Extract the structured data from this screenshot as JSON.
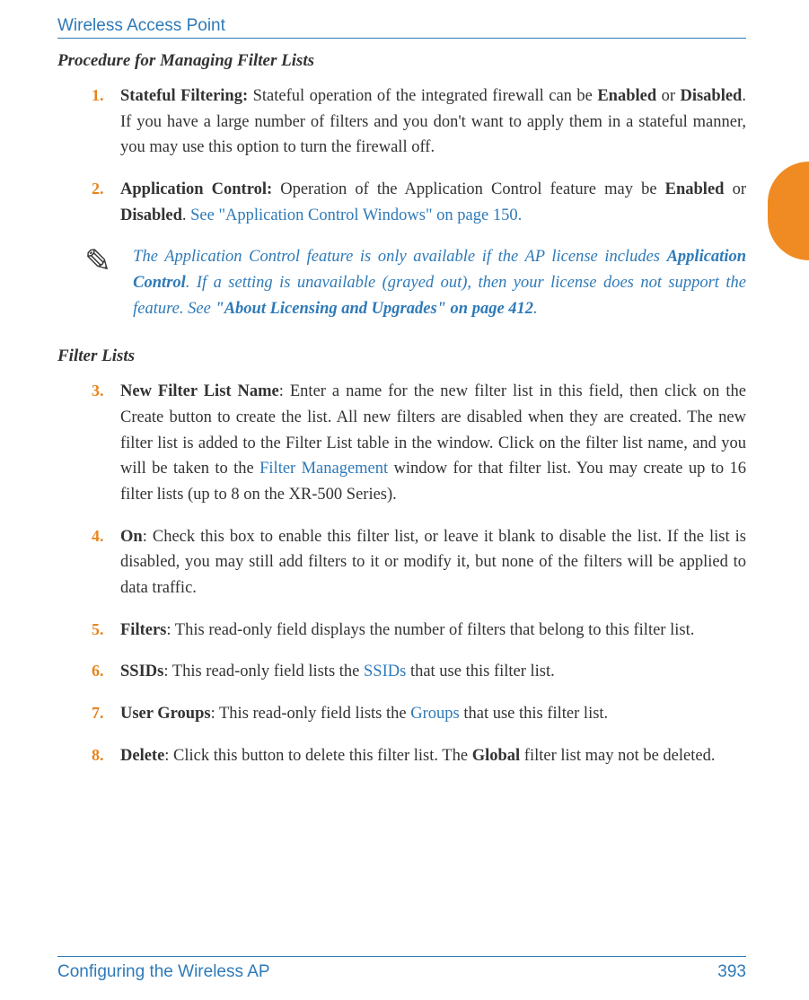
{
  "header": {
    "title": "Wireless Access Point"
  },
  "section1": {
    "heading": "Procedure for Managing Filter Lists"
  },
  "items": {
    "1": {
      "num": "1.",
      "label": "Stateful Filtering:",
      "text_a": " Stateful operation of the integrated firewall can be ",
      "b1": "Enabled",
      "mid": " or ",
      "b2": "Disabled",
      "text_b": ". If you have a large number of filters and you don't want to apply them in a stateful manner, you may use this option to turn the firewall off."
    },
    "2": {
      "num": "2.",
      "label": "Application Control:",
      "text_a": " Operation of the Application Control feature may be ",
      "b1": "Enabled",
      "mid": " or ",
      "b2": "Disabled",
      "period": ". ",
      "link": "See \"Application Control Windows\" on page 150."
    },
    "3": {
      "num": "3.",
      "label": "New Filter List Name",
      "text_a": ": Enter a name for the new filter list in this field, then click on the Create button to create the list. All new filters are disabled when they are created. The new filter list is added to the Filter List table in the window. Click on the filter list name, and you will be taken to the ",
      "link": "Filter Management",
      "text_b": " window for that filter list. You may create up to 16 filter lists (up to 8 on the XR-500 Series)."
    },
    "4": {
      "num": "4.",
      "label": "On",
      "text": ": Check this box to enable this filter list, or leave it blank to disable the list. If the list is disabled, you may still add filters to it or modify it, but none of the filters will be applied to data traffic."
    },
    "5": {
      "num": "5.",
      "label": "Filters",
      "text": ": This read-only field displays the number of filters that belong to this filter list."
    },
    "6": {
      "num": "6.",
      "label": "SSIDs",
      "text_a": ": This read-only field lists the ",
      "link": "SSIDs",
      "text_b": " that use this filter list."
    },
    "7": {
      "num": "7.",
      "label": "User Groups",
      "text_a": ": This read-only field lists the ",
      "link": "Groups",
      "text_b": " that use this filter list."
    },
    "8": {
      "num": "8.",
      "label": "Delete",
      "text_a": ": Click this button to delete this filter list. The ",
      "b1": "Global",
      "text_b": " filter list may not be deleted."
    }
  },
  "note": {
    "icon": "✎",
    "t1": "The Application Control feature is only available if the AP license includes ",
    "b1": "Application Control",
    "t2": ". If a setting is unavailable (grayed out), then your license does not support the feature. See ",
    "b2": "\"About Licensing and Upgrades\" on page 412",
    "t3": "."
  },
  "section2": {
    "heading": "Filter Lists"
  },
  "footer": {
    "left": "Configuring the Wireless AP",
    "right": "393"
  }
}
